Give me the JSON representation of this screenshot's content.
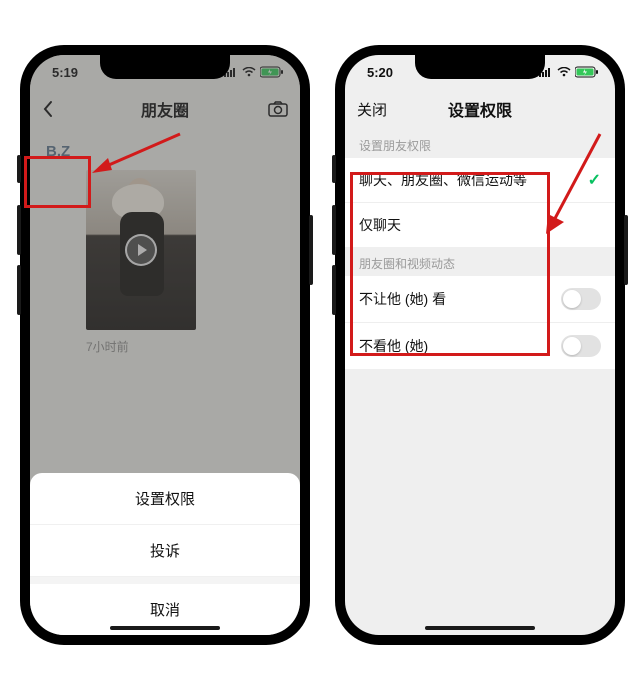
{
  "left": {
    "status": {
      "time": "5:19"
    },
    "nav": {
      "title": "朋友圈"
    },
    "user_name": "B.Z",
    "post_time": "7小时前",
    "sheet": {
      "set_permission": "设置权限",
      "report": "投诉",
      "cancel": "取消"
    }
  },
  "right": {
    "status": {
      "time": "5:20"
    },
    "nav": {
      "close": "关闭",
      "title": "设置权限"
    },
    "section1_header": "设置朋友权限",
    "opt_all": "聊天、朋友圈、微信运动等",
    "opt_chat_only": "仅聊天",
    "section2_header": "朋友圈和视频动态",
    "hide_my": "不让他 (她) 看",
    "hide_their": "不看他 (她)"
  },
  "icons": {
    "back": "chevron-left",
    "camera": "camera",
    "signal": "signal",
    "wifi": "wifi",
    "battery": "battery-charging"
  }
}
